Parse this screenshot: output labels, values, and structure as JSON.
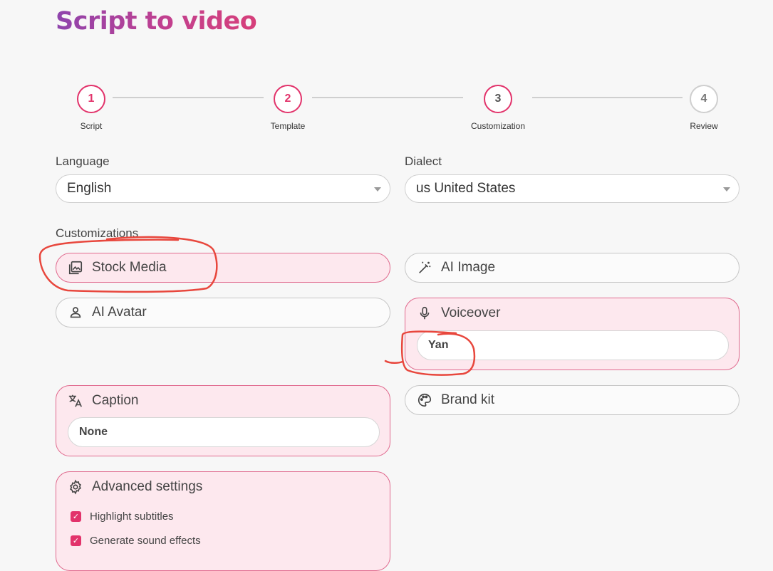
{
  "page": {
    "title": "Script to video"
  },
  "stepper": {
    "steps": [
      {
        "number": "1",
        "label": "Script"
      },
      {
        "number": "2",
        "label": "Template"
      },
      {
        "number": "3",
        "label": "Customization"
      },
      {
        "number": "4",
        "label": "Review"
      }
    ]
  },
  "language": {
    "label": "Language",
    "value": "English"
  },
  "dialect": {
    "label": "Dialect",
    "value": "us United States"
  },
  "customizations": {
    "label": "Customizations",
    "stock_media": "Stock Media",
    "ai_image": "AI Image",
    "ai_avatar": "AI Avatar",
    "voiceover": {
      "label": "Voiceover",
      "value": "Yan"
    },
    "caption": {
      "label": "Caption",
      "value": "None"
    },
    "brand_kit": "Brand kit",
    "advanced": {
      "label": "Advanced settings",
      "options": [
        {
          "label": "Highlight subtitles",
          "checked": true
        },
        {
          "label": "Generate sound effects",
          "checked": true
        }
      ]
    }
  },
  "colors": {
    "accent": "#e2336b",
    "selected_bg": "#fde8ee",
    "annotation": "#e8473d"
  },
  "icons": {
    "stock_media": "image-gallery-icon",
    "ai_image": "magic-wand-icon",
    "ai_avatar": "user-icon",
    "voiceover": "microphone-icon",
    "caption": "translate-icon",
    "brand_kit": "palette-icon",
    "advanced": "gear-icon"
  }
}
